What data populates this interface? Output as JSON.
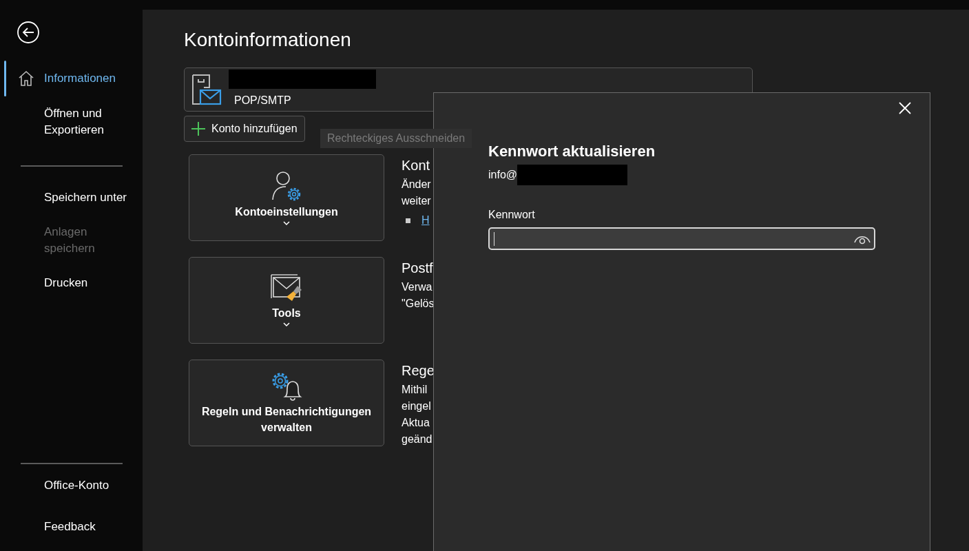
{
  "sidebar": {
    "top_items": [
      {
        "label": "Informationen",
        "selected": true,
        "disabled": false
      },
      {
        "label": "Öffnen und Exportieren",
        "selected": false,
        "disabled": false
      }
    ],
    "middle_items": [
      {
        "label": "Speichern unter",
        "selected": false,
        "disabled": false
      },
      {
        "label": "Anlagen speichern",
        "selected": false,
        "disabled": true
      },
      {
        "label": "Drucken",
        "selected": false,
        "disabled": false
      }
    ],
    "bottom_items": [
      {
        "label": "Office-Konto",
        "selected": false,
        "disabled": false
      },
      {
        "label": "Feedback",
        "selected": false,
        "disabled": false
      }
    ]
  },
  "main": {
    "title": "Kontoinformationen",
    "account": {
      "type": "POP/SMTP"
    },
    "add_button": "Konto hinzufügen",
    "tooltip": "Rechteckiges Ausschneiden",
    "sections": [
      {
        "kind": "settings",
        "button_label": "Kontoeinstellungen",
        "has_menu": true,
        "heading": "Kont",
        "lines": [
          "Änder",
          "weiter"
        ],
        "link": "H"
      },
      {
        "kind": "tools",
        "button_label": "Tools",
        "has_menu": true,
        "heading": "Postf",
        "lines": [
          "Verwa",
          "\"Gelös"
        ]
      },
      {
        "kind": "rules",
        "button_label": "Regeln und Benachrichtigungen verwalten",
        "has_menu": false,
        "heading": "Rege",
        "lines": [
          "Mithil",
          "eingel",
          "Aktua",
          "geänd"
        ]
      }
    ]
  },
  "dialog": {
    "title": "Kennwort aktualisieren",
    "email": "info@",
    "field_label": "Kennwort"
  }
}
